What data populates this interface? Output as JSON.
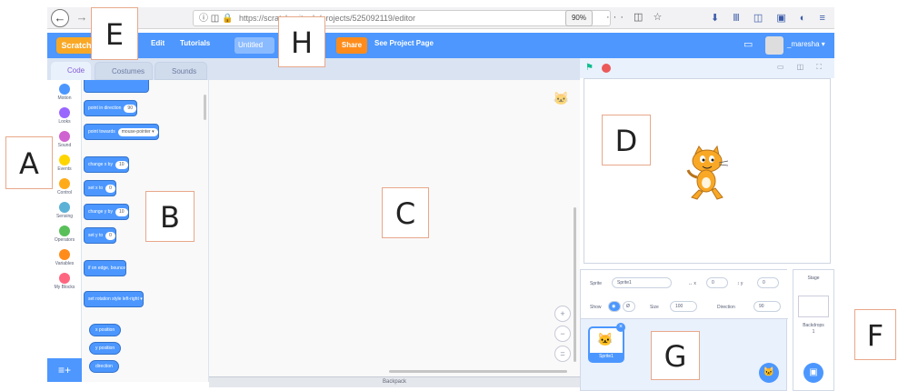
{
  "browser": {
    "back_icon": "arrow-left-icon",
    "back_glyph": "←",
    "forward_glyph": "→",
    "url_icons": "ⓘ ◫ 🔒",
    "url": "https://scratch.mit.edu/projects/525092119/editor",
    "zoom": "90%",
    "page_actions": "··· ◫ ☆",
    "toolbar_icons": "⬇ Ⅲ ◫ ▣ ◐ ≡"
  },
  "menu": {
    "logo": "Scratch",
    "edit": "Edit",
    "tutorials": "Tutorials",
    "project_title": "Untitled",
    "share": "Share",
    "see_project_page": "See Project Page",
    "folder_glyph": "▭",
    "username": "_maresha ▾"
  },
  "tabs": {
    "code": "Code",
    "costumes": "Costumes",
    "sounds": "Sounds"
  },
  "categories": [
    {
      "label": "Motion",
      "color": "#4c97ff"
    },
    {
      "label": "Looks",
      "color": "#9966ff"
    },
    {
      "label": "Sound",
      "color": "#cf63cf"
    },
    {
      "label": "Events",
      "color": "#ffd500"
    },
    {
      "label": "Control",
      "color": "#ffab19"
    },
    {
      "label": "Sensing",
      "color": "#5cb1d6"
    },
    {
      "label": "Operators",
      "color": "#59c059"
    },
    {
      "label": "Variables",
      "color": "#ff8c1a"
    },
    {
      "label": "My Blocks",
      "color": "#ff6680"
    }
  ],
  "extension_glyph": "≡+",
  "blocks": {
    "point_in_direction": "point in direction",
    "point_in_direction_val": "90",
    "point_towards": "point towards",
    "point_towards_val": "mouse-pointer ▾",
    "change_x": "change x by",
    "change_x_val": "10",
    "set_x": "set x to",
    "set_x_val": "0",
    "change_y": "change y by",
    "change_y_val": "10",
    "set_y": "set y to",
    "set_y_val": "0",
    "if_on_edge": "if on edge, bounce",
    "rotation_style": "set rotation style left-right ▾",
    "x_position": "x position",
    "y_position": "y position",
    "direction": "direction"
  },
  "code_area": {
    "zoom_in": "+",
    "zoom_out": "−",
    "zoom_reset": "=",
    "backpack": "Backpack"
  },
  "stage_controls": {
    "flag_glyph": "⚑",
    "mode_buttons": "▭ ◫ ⛶"
  },
  "sprite_info": {
    "sprite_label": "Sprite",
    "sprite_name": "Sprite1",
    "x_label": "↔ x",
    "x_value": "0",
    "y_label": "↕ y",
    "y_value": "0",
    "show_label": "Show",
    "show_visible": "◉",
    "show_hidden": "Ø",
    "size_label": "Size",
    "size_value": "100",
    "direction_label": "Direction",
    "direction_value": "90"
  },
  "sprite_list": {
    "thumb_label": "Sprite1",
    "delete_glyph": "×",
    "choose_glyph": "🐱"
  },
  "stage_pane": {
    "title": "Stage",
    "backdrops": "Backdrops",
    "backdrops_count": "1",
    "choose_glyph": "▣"
  },
  "annotations": {
    "A": "A",
    "B": "B",
    "C": "C",
    "D": "D",
    "E": "E",
    "F": "F",
    "G": "G",
    "H": "H"
  }
}
